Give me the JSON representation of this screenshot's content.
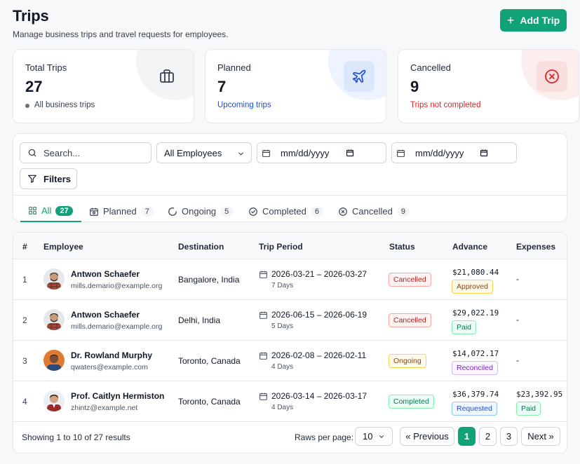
{
  "header": {
    "title": "Trips",
    "subtitle": "Manage business trips and travel requests for employees.",
    "add_button": "Add Trip"
  },
  "stats": [
    {
      "label": "Total Trips",
      "value": "27",
      "note": "All business trips",
      "note_color": "#374151",
      "icon": "briefcase-icon",
      "blob": "#f3f4f6",
      "icon_bg": "transparent",
      "icon_color": "#374151"
    },
    {
      "label": "Planned",
      "value": "7",
      "note": "Upcoming trips",
      "note_color": "#1d4ed8",
      "icon": "airplane-icon",
      "blob": "#eef4ff",
      "icon_bg": "#dbe7fb",
      "icon_color": "#1d4ed8"
    },
    {
      "label": "Cancelled",
      "value": "9",
      "note": "Trips not completed",
      "note_color": "#dc2626",
      "icon": "x-circle-icon",
      "blob": "#fdeeee",
      "icon_bg": "#fbdede",
      "icon_color": "#dc2626"
    }
  ],
  "filters": {
    "search_placeholder": "Search...",
    "employee_select": "All Employees",
    "date_from_placeholder": "mm/dd/yyyy",
    "date_to_placeholder": "mm/dd/yyyy",
    "filters_button": "Filters"
  },
  "tabs": [
    {
      "label": "All",
      "count": "27"
    },
    {
      "label": "Planned",
      "count": "7"
    },
    {
      "label": "Ongoing",
      "count": "5"
    },
    {
      "label": "Completed",
      "count": "6"
    },
    {
      "label": "Cancelled",
      "count": "9"
    }
  ],
  "table": {
    "headers": [
      "#",
      "Employee",
      "Destination",
      "Trip Period",
      "Status",
      "Advance",
      "Expenses"
    ],
    "rows": [
      {
        "num": "1",
        "name": "Antwon Schaefer",
        "email": "mills.demario@example.org",
        "destination": "Bangalore, India",
        "period": "2026-03-21 – 2026-03-27",
        "days": "7 Days",
        "status": "Cancelled",
        "advance": "$21,080.44",
        "advance_status": "Approved",
        "expenses": "-",
        "expenses_status": ""
      },
      {
        "num": "2",
        "name": "Antwon Schaefer",
        "email": "mills.demario@example.org",
        "destination": "Delhi, India",
        "period": "2026-06-15 – 2026-06-19",
        "days": "5 Days",
        "status": "Cancelled",
        "advance": "$29,022.19",
        "advance_status": "Paid",
        "expenses": "-",
        "expenses_status": ""
      },
      {
        "num": "3",
        "name": "Dr. Rowland Murphy",
        "email": "qwaters@example.com",
        "destination": "Toronto, Canada",
        "period": "2026-02-08 – 2026-02-11",
        "days": "4 Days",
        "status": "Ongoing",
        "advance": "$14,072.17",
        "advance_status": "Reconciled",
        "expenses": "-",
        "expenses_status": ""
      },
      {
        "num": "4",
        "name": "Prof. Caitlyn Hermiston",
        "email": "zhintz@example.net",
        "destination": "Toronto, Canada",
        "period": "2026-03-14 – 2026-03-17",
        "days": "4 Days",
        "status": "Completed",
        "advance": "$36,379.74",
        "advance_status": "Requested",
        "expenses": "$23,392.95",
        "expenses_status": "Paid"
      }
    ]
  },
  "pagination": {
    "showing": "Showing 1 to 10 of 27 results",
    "rows_label": "Raws per page:",
    "rows_value": "10",
    "prev": "« Previous",
    "pages": [
      "1",
      "2",
      "3"
    ],
    "next": "Next »"
  },
  "colors": {
    "accent": "#12a27a"
  }
}
